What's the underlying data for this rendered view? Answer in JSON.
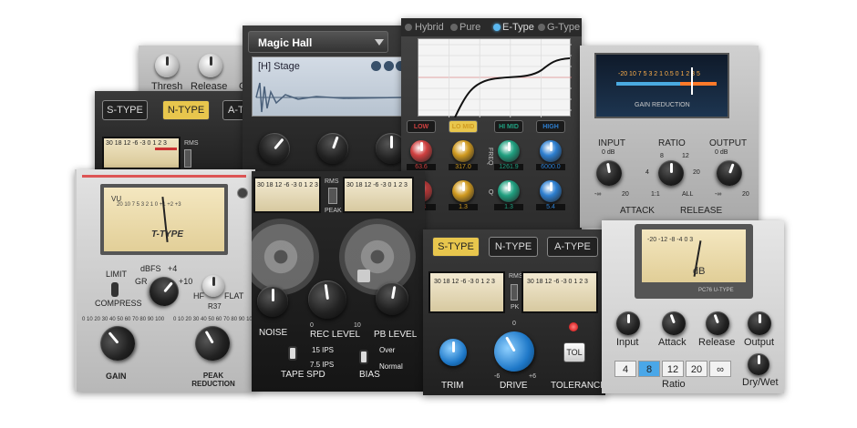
{
  "thresh_panel": {
    "knobs": [
      "Thresh",
      "Release"
    ],
    "partial": "G"
  },
  "ntype_panel": {
    "buttons": [
      "S-TYPE",
      "N-TYPE",
      "A-TYPE"
    ],
    "partial_button": "A-T",
    "meter_scale": "30 18 12 -6 -3 0 1 2 3",
    "rms": "RMS"
  },
  "reverb": {
    "preset": "Magic Hall",
    "sub_preset": "[H] Stage"
  },
  "eq": {
    "modes": [
      "Hybrid",
      "Pure",
      "E-Type",
      "G-Type"
    ],
    "active_mode": "E-Type",
    "y_labels": [
      "18",
      "12",
      "6",
      "0",
      "-6",
      "-12",
      "-18"
    ],
    "x_labels": [
      "20",
      "112",
      "632",
      "3K7",
      "20K"
    ],
    "bands": [
      {
        "name": "LOW",
        "freq": "63.6",
        "q": "1.3",
        "color": "#d04040"
      },
      {
        "name": "LO MID",
        "freq": "317.0",
        "q": "1.3",
        "color": "#d09a20"
      },
      {
        "name": "HI MID",
        "freq": "1261.9",
        "q": "1.3",
        "color": "#20a080"
      },
      {
        "name": "HIGH",
        "freq": "6000.0",
        "q": "5.4",
        "color": "#2e7fd0"
      }
    ],
    "freq_label": "FREQ",
    "q_label": "Q"
  },
  "gain_reduction": {
    "meter_scale": "-20 10 7 5 3 2 1 0.5 0 1 2 3 5",
    "meter_title": "GAIN REDUCTION",
    "input_label": "INPUT",
    "input_db": "0 dB",
    "input_min": "-∞",
    "input_max": "20",
    "ratio_label": "RATIO",
    "ratio_ticks": [
      "8",
      "12",
      "4",
      "20",
      "1:1",
      "ALL"
    ],
    "output_label": "OUTPUT",
    "output_db": "0 dB",
    "output_min": "-∞",
    "output_max": "20",
    "attack_label": "ATTACK",
    "release_label": "RELEASE"
  },
  "ttype": {
    "vu": "VU",
    "brand": "T-TYPE",
    "scale": "20 10 7 5 3 2 1 0 +1 +2 +3",
    "limit": "LIMIT",
    "compress": "COMPRESS",
    "dbfs": "dBFS",
    "plus4": "+4",
    "gr": "GR",
    "plus10": "+10",
    "hf": "HF",
    "flat": "FLAT",
    "r37": "R37",
    "gain": "GAIN",
    "peak_reduction": "PEAK REDUCTION",
    "dial_nums": "0 10 20 30 40 50 60 70 80 90 100"
  },
  "tape": {
    "noise": "NOISE",
    "rec_level": "REC LEVEL",
    "pb_level": "PB LEVEL",
    "rec_min": "0",
    "rec_max": "10",
    "tape_spd": "TAPE SPD",
    "speed_hi": "15 IPS",
    "speed_lo": "7.5 IPS",
    "bias": "BIAS",
    "bias_hi": "Over",
    "bias_lo": "Normal",
    "rms": "RMS",
    "peak": "PEAK",
    "meter_scale": "30 18 12 -6 -3 0 1 2 3"
  },
  "saturation": {
    "buttons": [
      "S-TYPE",
      "N-TYPE",
      "A-TYPE"
    ],
    "active": "S-TYPE",
    "trim": "TRIM",
    "drive": "DRIVE",
    "tolerance": "TOLERANCE",
    "tol_button": "TOL",
    "rms": "RMS",
    "pk": "PK",
    "drive_min": "-6",
    "drive_max": "+6",
    "drive_top": "0",
    "meter_scale": "30 18 12 -6 -3 0 1 2 3"
  },
  "utype": {
    "meter_scale": "-20 -12 -8 -4 0 3",
    "db": "dB",
    "brand": "PC76 U-TYPE",
    "knobs": [
      "Input",
      "Attack",
      "Release",
      "Output"
    ],
    "ratio_options": [
      "4",
      "8",
      "12",
      "20",
      "∞"
    ],
    "ratio_selected": "8",
    "ratio_label": "Ratio",
    "drywet": "Dry/Wet"
  }
}
